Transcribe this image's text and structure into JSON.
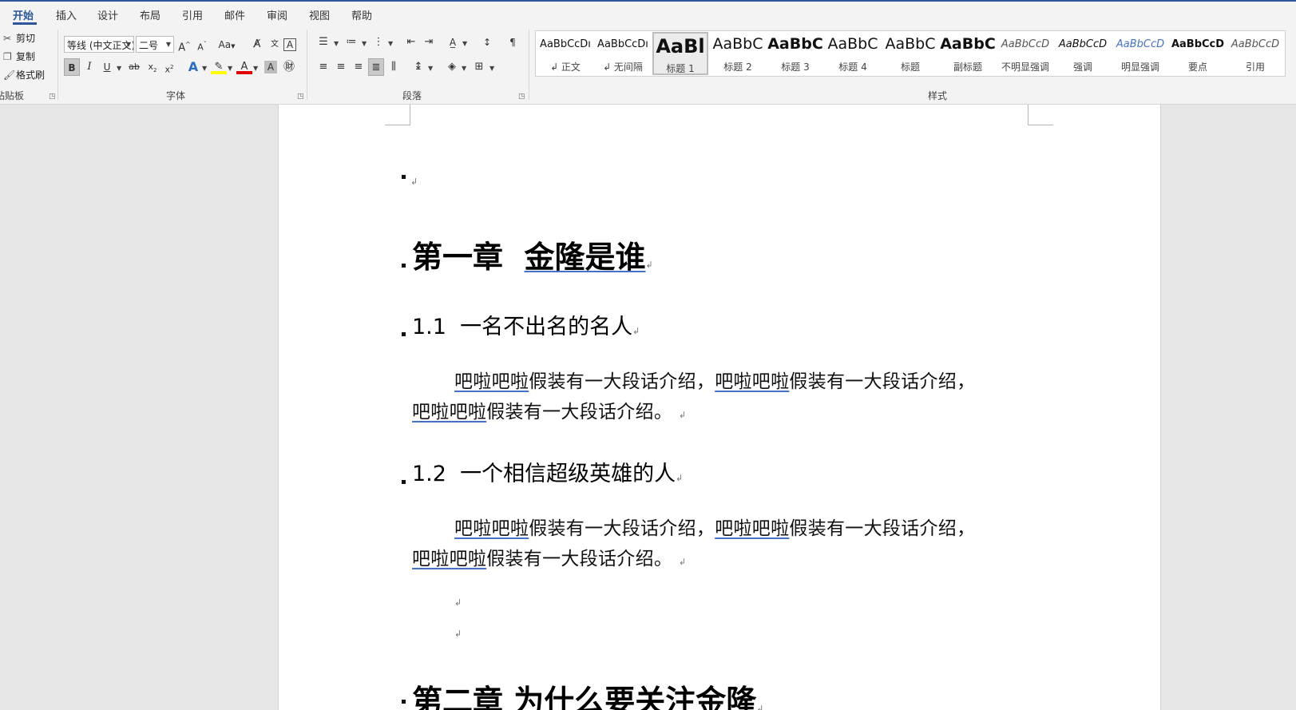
{
  "tabs": [
    "开始",
    "插入",
    "设计",
    "布局",
    "引用",
    "邮件",
    "审阅",
    "视图",
    "帮助"
  ],
  "clipboard": {
    "cut": "剪切",
    "copy": "复制",
    "format_painter": "格式刷",
    "label": "粘贴板"
  },
  "font": {
    "name": "等线 (中文正文)",
    "size": "二号",
    "label": "字体",
    "change_case": "Aa",
    "grow": "A",
    "shrink": "A"
  },
  "paragraph": {
    "label": "段落"
  },
  "styles": {
    "label": "样式",
    "items": [
      {
        "preview": "AaBbCcDı",
        "name": "↲ 正文"
      },
      {
        "preview": "AaBbCcDı",
        "name": "↲ 无间隔"
      },
      {
        "preview": "AaBl",
        "name": "标题 1"
      },
      {
        "preview": "AaBbC",
        "name": "标题 2"
      },
      {
        "preview": "AaBbC",
        "name": "标题 3"
      },
      {
        "preview": "AaBbC",
        "name": "标题 4"
      },
      {
        "preview": "AaBbC",
        "name": "标题"
      },
      {
        "preview": "AaBbC",
        "name": "副标题"
      },
      {
        "preview": "AaBbCcD",
        "name": "不明显强调"
      },
      {
        "preview": "AaBbCcD",
        "name": "强调"
      },
      {
        "preview": "AaBbCcD",
        "name": "明显强调"
      },
      {
        "preview": "AaBbCcD",
        "name": "要点"
      },
      {
        "preview": "AaBbCcD",
        "name": "引用"
      }
    ]
  },
  "document": {
    "para_mark": "↲",
    "chapter1_num": "第一章",
    "chapter1_title": "金隆是谁",
    "sec1_num": "1.1",
    "sec1_title": "一名不出名的名人",
    "sec2_num": "1.2",
    "sec2_title": "一个相信超级英雄的人",
    "body_u": "吧啦吧啦",
    "body_rest_comma": "假装有一大段话介绍，",
    "body_rest_period": "假装有一大段话介绍。",
    "chapter2_text": "第二章  为什么要关注金隆"
  }
}
